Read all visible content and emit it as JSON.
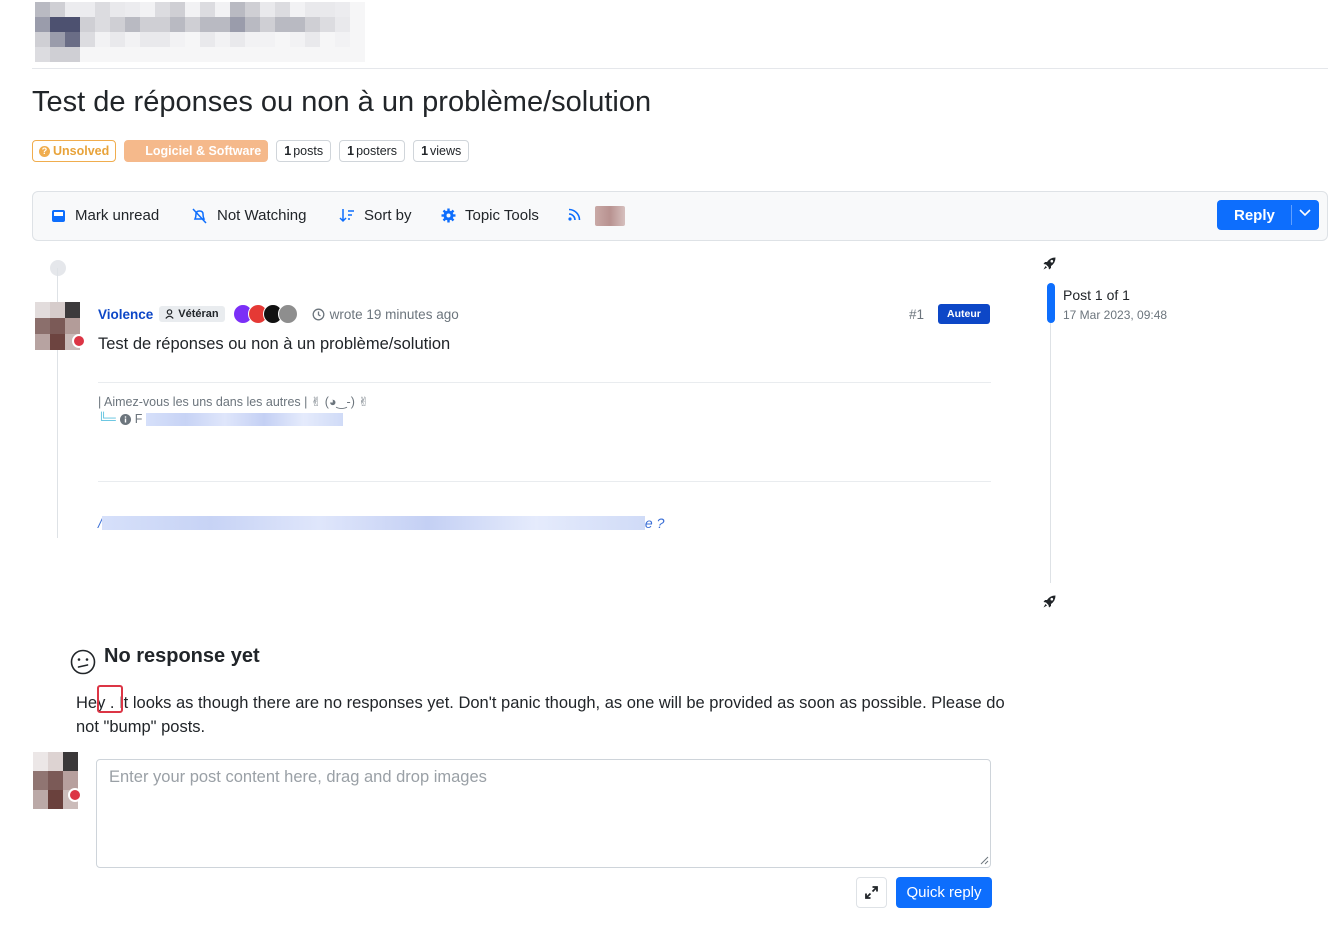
{
  "topic": {
    "title": "Test de réponses ou non à un problème/solution",
    "tags": {
      "status": "Unsolved",
      "status_icon": "?",
      "category": "Logiciel & Software",
      "posts_count": "1",
      "posts_label": "posts",
      "posters_count": "1",
      "posters_label": "posters",
      "views_count": "1",
      "views_label": "views"
    }
  },
  "toolbar": {
    "mark_unread": "Mark unread",
    "not_watching": "Not Watching",
    "sort_by": "Sort by",
    "topic_tools": "Topic Tools",
    "reply": "Reply"
  },
  "post": {
    "author": "Violence",
    "rank": "Vétéran",
    "wrote": "wrote 19 minutes ago",
    "number": "#1",
    "author_badge": "Auteur",
    "content": "Test de réponses ou non à un problème/solution",
    "signature_line1": "| Aimez-vous les uns dans les autres | ✌ (◕‿-) ✌",
    "signature_prefix": "╚═",
    "signature_line2_start": "F",
    "link_start": "/",
    "link_end": "e ?"
  },
  "timeline": {
    "position": "Post 1 of 1",
    "date": "17 Mar 2023, 09:48"
  },
  "no_response": {
    "title": "No response yet",
    "text": "Hey . It looks as though there are no responses yet. Don't panic though, as one will be provided as soon as possible. Please do not \"bump\" posts."
  },
  "composer": {
    "placeholder": "Enter your post content here, drag and drop images",
    "quick_reply": "Quick reply"
  },
  "colors": {
    "accent": "#0d6efd",
    "author_blue": "#0d47c7",
    "unsolved": "#f0ad4e",
    "category": "#f5b98b",
    "status_offline": "#dc3545"
  }
}
